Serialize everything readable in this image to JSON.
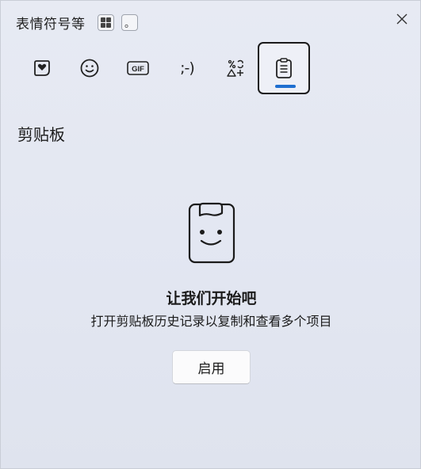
{
  "window": {
    "title": "表情符号等"
  },
  "shortcut": {
    "dot_key": "。"
  },
  "tabs": [
    {
      "name": "emoji",
      "icon": "heart-sticker-icon"
    },
    {
      "name": "kaomoji-smiley",
      "icon": "smiley-icon"
    },
    {
      "name": "gif",
      "label": "GIF",
      "icon": "gif-icon"
    },
    {
      "name": "kaomoji",
      "label": ";-)",
      "icon": "kaomoji-icon"
    },
    {
      "name": "symbols",
      "icon": "symbols-icon"
    },
    {
      "name": "clipboard",
      "icon": "clipboard-icon",
      "active": true
    }
  ],
  "section": {
    "title": "剪贴板"
  },
  "empty_state": {
    "heading": "让我们开始吧",
    "description": "打开剪贴板历史记录以复制和查看多个项目",
    "button_label": "启用"
  },
  "colors": {
    "accent": "#1f6fd0",
    "background": "#e3e7f2",
    "text": "#1b1b1b"
  }
}
